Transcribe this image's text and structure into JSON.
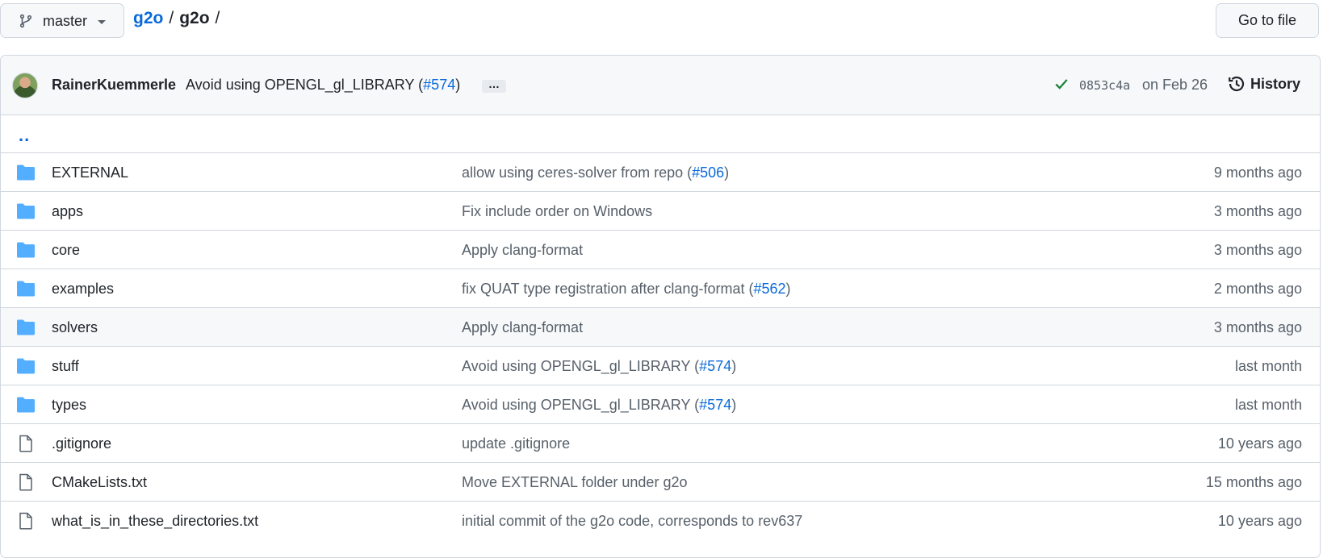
{
  "branch": {
    "label": "master",
    "icon": "git-branch-icon"
  },
  "breadcrumb": {
    "repo": "g2o",
    "separator": "/",
    "current": "g2o",
    "trailing": "/"
  },
  "goto_file": {
    "label": "Go to file"
  },
  "latest_commit": {
    "author": "RainerKuemmerle",
    "message_prefix": "Avoid using OPENGL_gl_LIBRARY (",
    "pr": "#574",
    "message_suffix": ")",
    "ellipsis": "…",
    "sha": "0853c4a",
    "date": "on Feb 26",
    "history_label": "History"
  },
  "parent_dir": {
    "label": ".."
  },
  "colors": {
    "link": "#0969da",
    "folder": "#54aeff",
    "check": "#1a7f37",
    "muted": "#57606a"
  },
  "rows": [
    {
      "type": "folder",
      "name": "EXTERNAL",
      "msg_text": "allow using ceres-solver from repo (",
      "msg_pr": "#506",
      "msg_end": ")",
      "age": "9 months ago"
    },
    {
      "type": "folder",
      "name": "apps",
      "msg_text": "Fix include order on Windows",
      "msg_pr": "",
      "msg_end": "",
      "age": "3 months ago"
    },
    {
      "type": "folder",
      "name": "core",
      "msg_text": "Apply clang-format",
      "msg_pr": "",
      "msg_end": "",
      "age": "3 months ago"
    },
    {
      "type": "folder",
      "name": "examples",
      "msg_text": "fix QUAT type registration after clang-format (",
      "msg_pr": "#562",
      "msg_end": ")",
      "age": "2 months ago"
    },
    {
      "type": "folder",
      "name": "solvers",
      "msg_text": "Apply clang-format",
      "msg_pr": "",
      "msg_end": "",
      "age": "3 months ago",
      "highlighted": true
    },
    {
      "type": "folder",
      "name": "stuff",
      "msg_text": "Avoid using OPENGL_gl_LIBRARY (",
      "msg_pr": "#574",
      "msg_end": ")",
      "age": "last month"
    },
    {
      "type": "folder",
      "name": "types",
      "msg_text": "Avoid using OPENGL_gl_LIBRARY (",
      "msg_pr": "#574",
      "msg_end": ")",
      "age": "last month"
    },
    {
      "type": "file",
      "name": ".gitignore",
      "msg_text": "update .gitignore",
      "msg_pr": "",
      "msg_end": "",
      "age": "10 years ago"
    },
    {
      "type": "file",
      "name": "CMakeLists.txt",
      "msg_text": "Move EXTERNAL folder under g2o",
      "msg_pr": "",
      "msg_end": "",
      "age": "15 months ago"
    },
    {
      "type": "file",
      "name": "what_is_in_these_directories.txt",
      "msg_text": "initial commit of the g2o code, corresponds to rev637",
      "msg_pr": "",
      "msg_end": "",
      "age": "10 years ago"
    }
  ]
}
